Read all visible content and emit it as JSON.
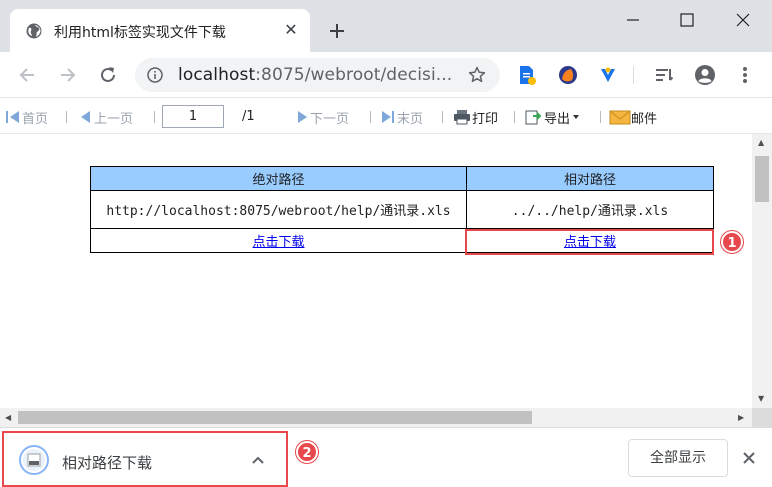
{
  "browser": {
    "tab_title": "利用html标签实现文件下载",
    "tab_close": "✕",
    "url_host": "localhost",
    "url_rest": ":8075/webroot/decisi..."
  },
  "report_toolbar": {
    "first_page": "首页",
    "prev_page": "上一页",
    "page_value": "1",
    "page_total": "/1",
    "next_page": "下一页",
    "last_page": "末页",
    "print": "打印",
    "export": "导出",
    "mail": "邮件"
  },
  "table": {
    "headers": [
      "绝对路径",
      "相对路径"
    ],
    "paths": [
      "http://localhost:8075/webroot/help/通讯录.xls",
      "../../help/通讯录.xls"
    ],
    "links": [
      "点击下载",
      "点击下载"
    ]
  },
  "annotations": {
    "badge_1": "1",
    "badge_2": "2"
  },
  "download_shelf": {
    "file_name": "相对路径下载",
    "show_all": "全部显示"
  },
  "colors": {
    "header_bg": "#99ccff",
    "highlight": "#e8474b",
    "link": "#0000ee"
  }
}
